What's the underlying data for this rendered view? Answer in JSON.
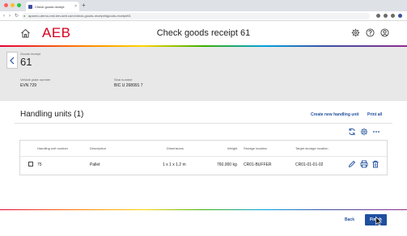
{
  "browser": {
    "tab_title": "Check goods receipt",
    "tab_close": "×",
    "new_tab": "+",
    "url": "aparmo-demo-rest.dev.aeb.com/check-goods-receipt/#goods-receipt/61",
    "traffic_lights": [
      "#ff5f57",
      "#febc2e",
      "#28c840"
    ]
  },
  "header": {
    "logo": "AEB",
    "title": "Check goods receipt 61",
    "icons": [
      "home-icon",
      "settings-icon",
      "help-icon",
      "user-icon"
    ]
  },
  "info": {
    "goods_receipt_label": "Goods receipt",
    "goods_receipt_value": "61",
    "vehicle_plate_label": "Vehicle plate number",
    "vehicle_plate_value": "EVN 729",
    "seal_label": "Seal number",
    "seal_value": "BIC U 268991 7"
  },
  "handling_units": {
    "title": "Handling units (1)",
    "create_link": "Create new handling unit",
    "print_link": "Print all",
    "toolbar_icons": [
      "refresh-icon",
      "settings-icon",
      "more-icon"
    ],
    "columns": [
      "Handling unit number",
      "Description",
      "Dimensions",
      "Weight",
      "Storage location",
      "Target storage location"
    ],
    "rows": [
      {
        "number": "75",
        "description": "Pallet",
        "dimensions": "1 x 1 x 1.2 m",
        "weight": "760.000 kg",
        "storage_location": "CR01-BUFFER",
        "target_storage_location": "CR01-01-01-02",
        "actions": [
          "edit-icon",
          "print-icon",
          "delete-icon"
        ]
      }
    ]
  },
  "footer": {
    "back_label": "Back",
    "finish_label": "Finish"
  },
  "colors": {
    "brand_red": "#d7001d",
    "primary_blue": "#1f4f9e",
    "panel_gray": "#e8e8e8"
  }
}
